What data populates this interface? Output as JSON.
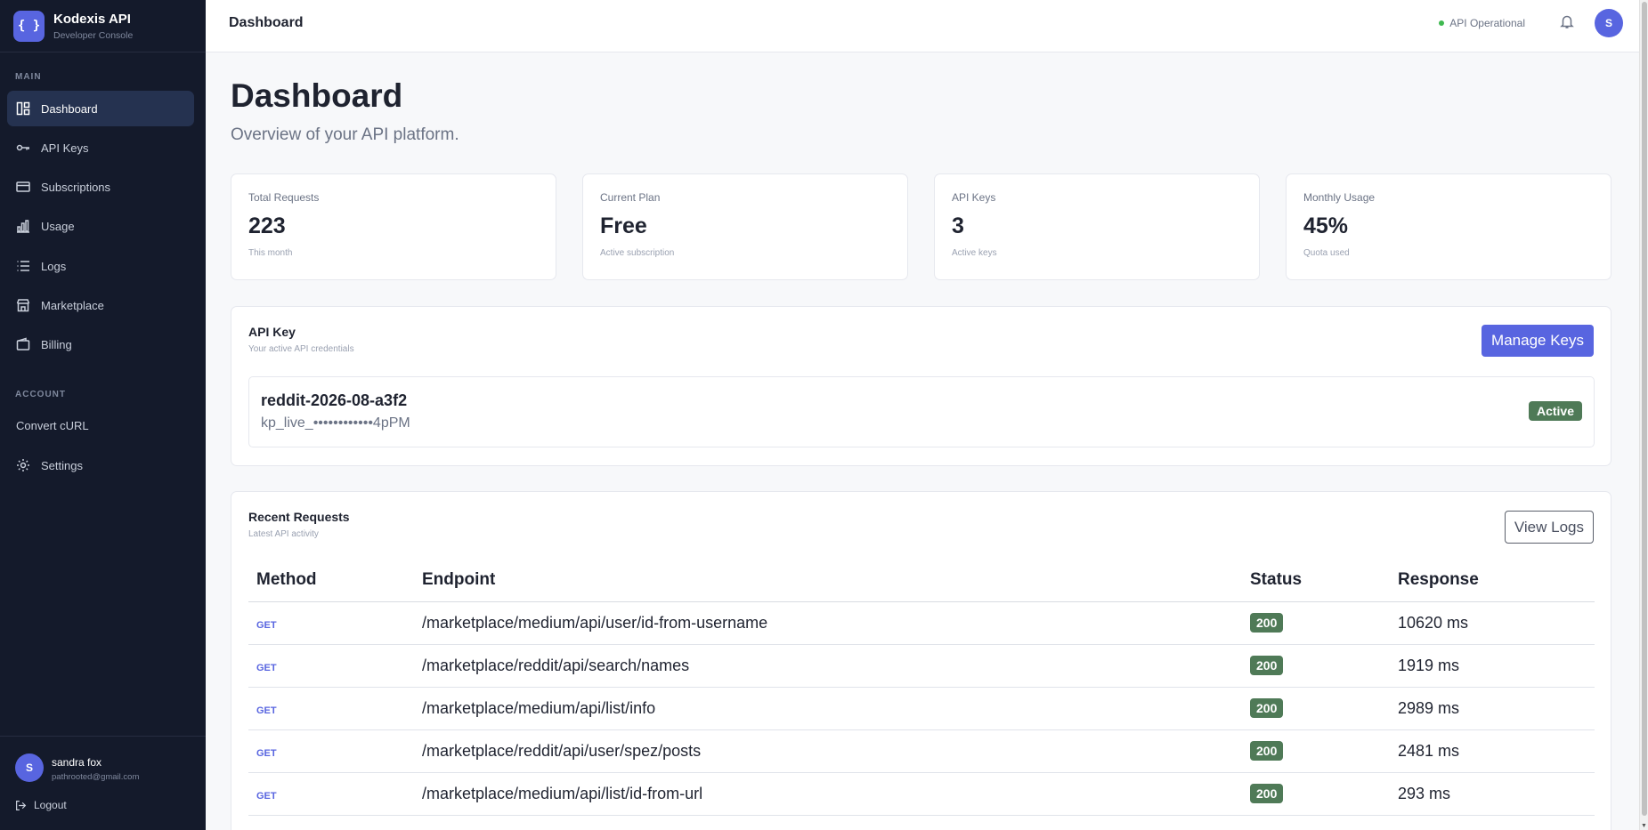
{
  "brand": {
    "logo": "{ }",
    "title": "Kodexis API",
    "subtitle": "Developer Console"
  },
  "sidebar": {
    "main_label": "MAIN",
    "items": [
      {
        "label": "Dashboard",
        "icon": "dashboard-icon",
        "active": true
      },
      {
        "label": "API Keys",
        "icon": "key-icon"
      },
      {
        "label": "Subscriptions",
        "icon": "card-icon"
      },
      {
        "label": "Usage",
        "icon": "bar-chart-icon"
      },
      {
        "label": "Logs",
        "icon": "list-icon"
      },
      {
        "label": "Marketplace",
        "icon": "store-icon"
      },
      {
        "label": "Billing",
        "icon": "wallet-icon"
      }
    ],
    "account_label": "ACCOUNT",
    "account_items": [
      {
        "label": "Convert cURL"
      },
      {
        "label": "Settings",
        "icon": "gear-icon"
      }
    ],
    "user": {
      "initial": "S",
      "name": "sandra fox",
      "email": "pathrooted@gmail.com"
    },
    "logout_label": "Logout"
  },
  "header": {
    "title": "Dashboard",
    "api_status": "API Operational",
    "avatar_initial": "S"
  },
  "page": {
    "title": "Dashboard",
    "subtitle": "Overview of your API platform."
  },
  "stats": [
    {
      "label": "Total Requests",
      "value": "223",
      "note": "This month"
    },
    {
      "label": "Current Plan",
      "value": "Free",
      "note": "Active subscription"
    },
    {
      "label": "API Keys",
      "value": "3",
      "note": "Active keys"
    },
    {
      "label": "Monthly Usage",
      "value": "45%",
      "note": "Quota used"
    }
  ],
  "api_key": {
    "title": "API Key",
    "subtitle": "Your active API credentials",
    "manage_label": "Manage Keys",
    "name": "reddit-2026-08-a3f2",
    "masked": "kp_live_••••••••••••4pPM",
    "status": "Active"
  },
  "requests": {
    "title": "Recent Requests",
    "subtitle": "Latest API activity",
    "view_logs_label": "View Logs",
    "columns": [
      "Method",
      "Endpoint",
      "Status",
      "Response"
    ],
    "rows": [
      {
        "method": "GET",
        "endpoint": "/marketplace/medium/api/user/id-from-username",
        "status": "200",
        "response": "10620 ms"
      },
      {
        "method": "GET",
        "endpoint": "/marketplace/reddit/api/search/names",
        "status": "200",
        "response": "1919 ms"
      },
      {
        "method": "GET",
        "endpoint": "/marketplace/medium/api/list/info",
        "status": "200",
        "response": "2989 ms"
      },
      {
        "method": "GET",
        "endpoint": "/marketplace/reddit/api/user/spez/posts",
        "status": "200",
        "response": "2481 ms"
      },
      {
        "method": "GET",
        "endpoint": "/marketplace/medium/api/list/id-from-url",
        "status": "200",
        "response": "293 ms"
      }
    ]
  },
  "colors": {
    "accent": "#5865e0",
    "sidebar_bg": "#141a2b",
    "success": "#4f7a57",
    "status_dot": "#3fb950"
  }
}
